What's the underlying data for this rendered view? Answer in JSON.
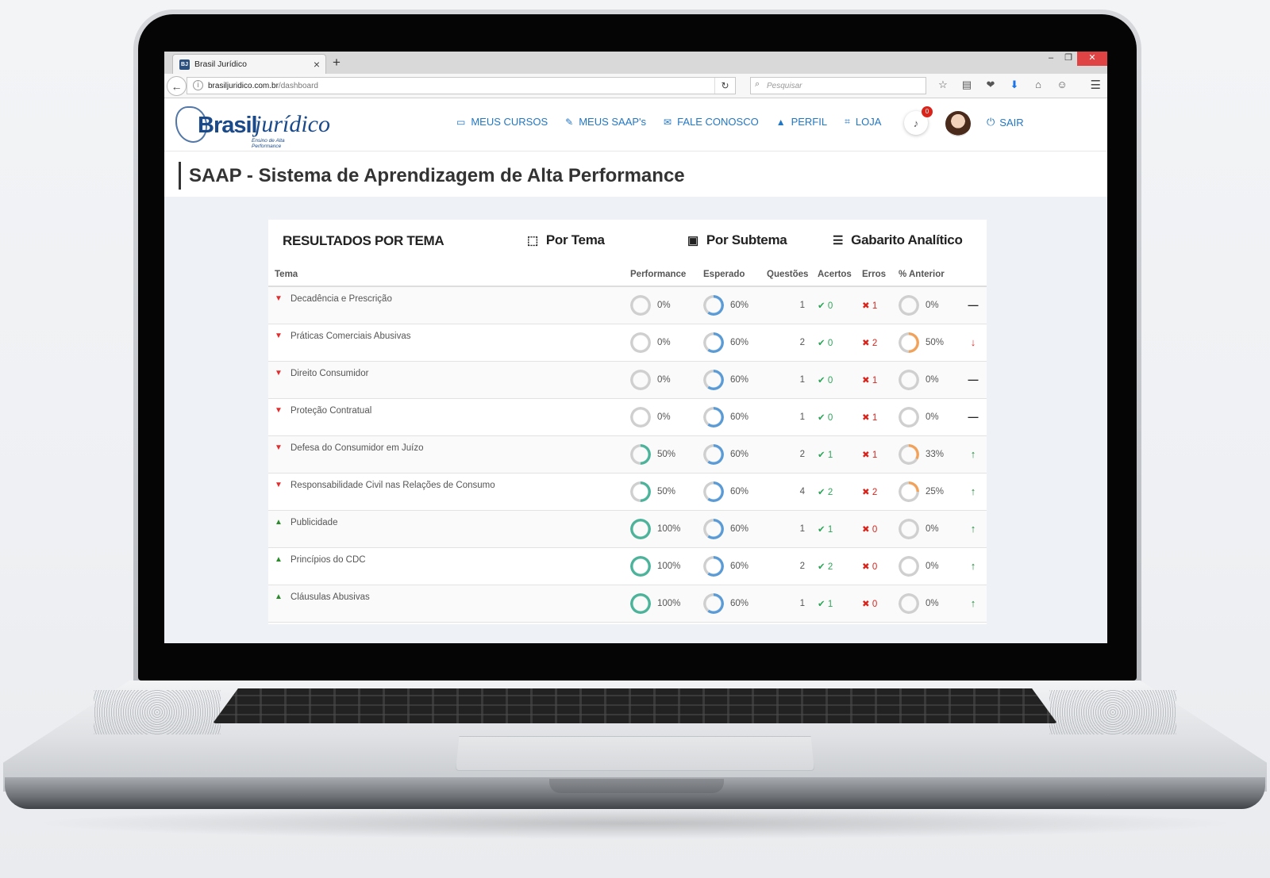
{
  "browser": {
    "tab_title": "Brasil Jurídico",
    "tab_favicon_text": "BJ",
    "new_tab": "+",
    "url_host": "brasiljuridico.com.br",
    "url_path": "/dashboard",
    "search_placeholder": "Pesquisar",
    "window_controls": [
      "–",
      "❐",
      "✕"
    ]
  },
  "header": {
    "logo_brasil": "Brasil",
    "logo_juridico": "jurídico",
    "logo_tagline": "Ensino de Alta Performance",
    "nav": [
      {
        "icon": "monitor-icon",
        "label": "MEUS CURSOS"
      },
      {
        "icon": "edit-icon",
        "label": "MEUS SAAP's"
      },
      {
        "icon": "envelope-icon",
        "label": "FALE CONOSCO"
      },
      {
        "icon": "user-icon",
        "label": "PERFIL"
      },
      {
        "icon": "cart-icon",
        "label": "LOJA"
      }
    ],
    "notifications_count": "0",
    "logout_label": "SAIR"
  },
  "page": {
    "title": "SAAP - Sistema de Aprendizagem de Alta Performance"
  },
  "results": {
    "title": "RESULTADOS POR TEMA",
    "tabs": {
      "por_tema": "Por Tema",
      "por_subtema": "Por Subtema",
      "gabarito": "Gabarito Analítico"
    },
    "columns": {
      "tema": "Tema",
      "performance": "Performance",
      "esperado": "Esperado",
      "questoes": "Questões",
      "acertos": "Acertos",
      "erros": "Erros",
      "anterior": "% Anterior"
    },
    "rows": [
      {
        "tema": "Decadência e Prescrição",
        "status": "down",
        "performance": "0%",
        "performance_value": 0,
        "esperado": "60%",
        "esperado_value": 60,
        "questoes": "1",
        "acertos": "0",
        "erros": "1",
        "anterior": "0%",
        "anterior_value": 0,
        "trend": "flat"
      },
      {
        "tema": "Práticas Comerciais Abusivas",
        "status": "down",
        "performance": "0%",
        "performance_value": 0,
        "esperado": "60%",
        "esperado_value": 60,
        "questoes": "2",
        "acertos": "0",
        "erros": "2",
        "anterior": "50%",
        "anterior_value": 50,
        "trend": "down"
      },
      {
        "tema": "Direito Consumidor",
        "status": "down",
        "performance": "0%",
        "performance_value": 0,
        "esperado": "60%",
        "esperado_value": 60,
        "questoes": "1",
        "acertos": "0",
        "erros": "1",
        "anterior": "0%",
        "anterior_value": 0,
        "trend": "flat"
      },
      {
        "tema": "Proteção Contratual",
        "status": "down",
        "performance": "0%",
        "performance_value": 0,
        "esperado": "60%",
        "esperado_value": 60,
        "questoes": "1",
        "acertos": "0",
        "erros": "1",
        "anterior": "0%",
        "anterior_value": 0,
        "trend": "flat"
      },
      {
        "tema": "Defesa do Consumidor em Juízo",
        "status": "down",
        "performance": "50%",
        "performance_value": 50,
        "esperado": "60%",
        "esperado_value": 60,
        "questoes": "2",
        "acertos": "1",
        "erros": "1",
        "anterior": "33%",
        "anterior_value": 33,
        "trend": "up"
      },
      {
        "tema": "Responsabilidade Civil nas Relações de Consumo",
        "status": "down",
        "performance": "50%",
        "performance_value": 50,
        "esperado": "60%",
        "esperado_value": 60,
        "questoes": "4",
        "acertos": "2",
        "erros": "2",
        "anterior": "25%",
        "anterior_value": 25,
        "trend": "up"
      },
      {
        "tema": "Publicidade",
        "status": "up",
        "performance": "100%",
        "performance_value": 100,
        "esperado": "60%",
        "esperado_value": 60,
        "questoes": "1",
        "acertos": "1",
        "erros": "0",
        "anterior": "0%",
        "anterior_value": 0,
        "trend": "up"
      },
      {
        "tema": "Princípios do CDC",
        "status": "up",
        "performance": "100%",
        "performance_value": 100,
        "esperado": "60%",
        "esperado_value": 60,
        "questoes": "2",
        "acertos": "2",
        "erros": "0",
        "anterior": "0%",
        "anterior_value": 0,
        "trend": "up"
      },
      {
        "tema": "Cláusulas Abusivas",
        "status": "up",
        "performance": "100%",
        "performance_value": 100,
        "esperado": "60%",
        "esperado_value": 60,
        "questoes": "1",
        "acertos": "1",
        "erros": "0",
        "anterior": "0%",
        "anterior_value": 0,
        "trend": "up"
      }
    ]
  },
  "colors": {
    "link_blue": "#2277c4",
    "performance_ring": "#4cb39a",
    "esperado_ring": "#5b9bd5",
    "anterior_ring": "#f0a15a",
    "ring_track": "#cfcfcf",
    "success": "#2ea65a",
    "danger": "#d9241c"
  }
}
